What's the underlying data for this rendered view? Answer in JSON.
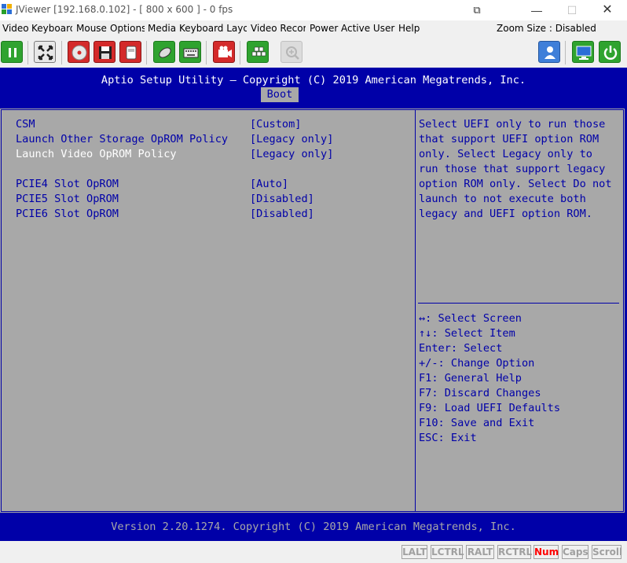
{
  "window": {
    "title": "JViewer [192.168.0.102] - [ 800 x 600 ] - 0 fps",
    "restore_glyph": "⧉",
    "minimize_glyph": "—",
    "maximize_glyph": "☐",
    "close_glyph": "✕"
  },
  "menu": {
    "items": [
      "Video",
      "Keyboard",
      "Mouse",
      "Options",
      "Media",
      "Keyboard Layout",
      "Video Record",
      "Power",
      "Active User",
      "Help"
    ],
    "zoom_label": "Zoom Size : Disabled"
  },
  "toolbar": {
    "icons": [
      "pause-icon",
      "fullscreen-icon",
      "cd-media-icon",
      "floppy-icon",
      "usb-drive-icon",
      "mouse-icon",
      "keyboard-icon",
      "video-record-icon",
      "hotkeys-icon",
      "zoom-icon",
      "user-icon",
      "monitor-icon",
      "power-icon"
    ]
  },
  "bios": {
    "header": "Aptio Setup Utility – Copyright (C) 2019 American Megatrends, Inc.",
    "active_tab": "Boot",
    "options": [
      {
        "label": "CSM",
        "value": "[Custom]"
      },
      {
        "label": "Launch Other Storage OpROM Policy",
        "value": "[Legacy only]"
      },
      {
        "label": "Launch Video OpROM Policy",
        "value": "[Legacy only]"
      },
      {
        "label": "PCIE4 Slot OpROM",
        "value": "[Auto]"
      },
      {
        "label": "PCIE5 Slot OpROM",
        "value": "[Disabled]"
      },
      {
        "label": "PCIE6 Slot OpROM",
        "value": "[Disabled]"
      }
    ],
    "selected_option": "Launch Video OpROM Policy",
    "help": [
      "Select UEFI only to run those",
      "that support UEFI option ROM",
      "only. Select Legacy only to",
      "run those that support legacy",
      "option ROM only. Select Do not",
      "launch to not execute both",
      "legacy and UEFI option ROM."
    ],
    "keys": [
      "↔: Select Screen",
      "↑↓: Select Item",
      "Enter: Select",
      "+/-: Change Option",
      "F1: General Help",
      "F7: Discard Changes",
      "F9: Load UEFI Defaults",
      "F10: Save and Exit",
      "ESC: Exit"
    ],
    "footer": "Version 2.20.1274. Copyright (C) 2019 American Megatrends, Inc.",
    "colors": {
      "background": "#0000a8",
      "panel": "#a8a8a8",
      "highlight": "#ffffff"
    }
  },
  "status": {
    "keys": [
      "LALT",
      "LCTRL",
      "RALT",
      "RCTRL",
      "Num",
      "Caps",
      "Scroll"
    ],
    "active_keys": [
      "Num"
    ]
  }
}
